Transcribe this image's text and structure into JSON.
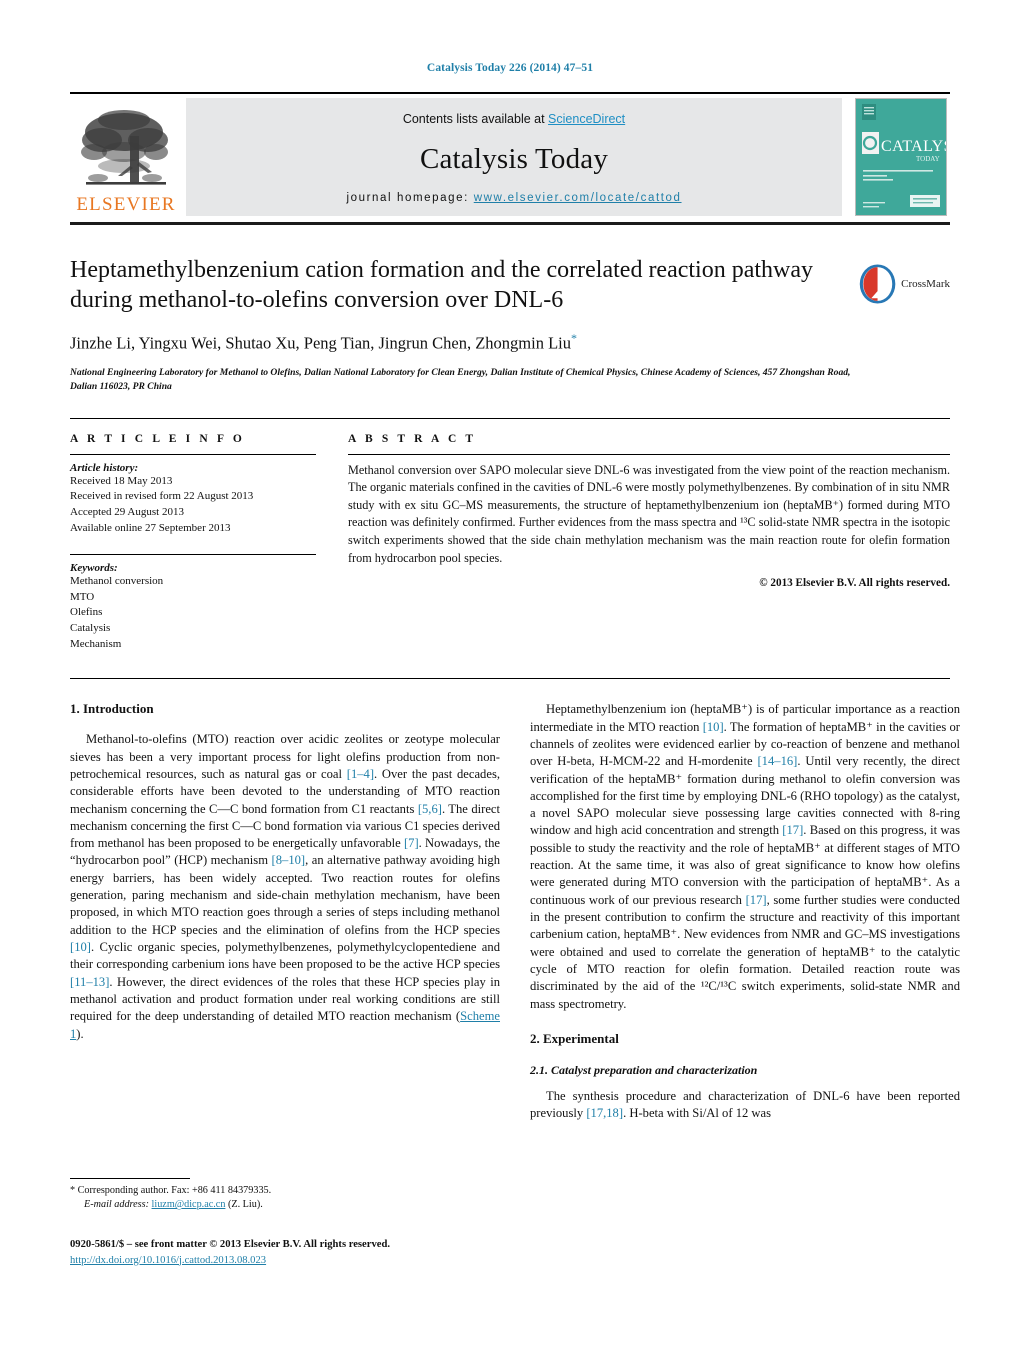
{
  "running_head": "Catalysis Today 226 (2014) 47–51",
  "header": {
    "contents_prefix": "Contents lists available at ",
    "sciencedirect": "ScienceDirect",
    "journal_title": "Catalysis Today",
    "homepage_prefix": "journal homepage:",
    "homepage_url": "www.elsevier.com/locate/cattod",
    "publisher_wordmark": "ELSEVIER",
    "cover_title": "CATALYSIS",
    "cover_subtitle": "TODAY",
    "accent_blue": "#1f7fa8",
    "elsevier_orange": "#E87722",
    "cover_teal": "#3fa89a",
    "band_gray": "#e6e7e8"
  },
  "title_block": {
    "title": "Heptamethylbenzenium cation formation and the correlated reaction pathway during methanol-to-olefins conversion over DNL-6",
    "authors": "Jinzhe Li, Yingxu Wei, Shutao Xu, Peng Tian, Jingrun Chen, Zhongmin Liu",
    "corresponding_marker": "*",
    "affiliation": "National Engineering Laboratory for Methanol to Olefins, Dalian National Laboratory for Clean Energy, Dalian Institute of Chemical Physics, Chinese Academy of Sciences, 457 Zhongshan Road, Dalian 116023, PR China",
    "crossmark_label": "CrossMark"
  },
  "article_info": {
    "heading": "A R T I C L E   I N F O",
    "history_label": "Article history:",
    "history": [
      "Received 18 May 2013",
      "Received in revised form 22 August 2013",
      "Accepted 29 August 2013",
      "Available online 27 September 2013"
    ],
    "keywords_label": "Keywords:",
    "keywords": [
      "Methanol conversion",
      "MTO",
      "Olefins",
      "Catalysis",
      "Mechanism"
    ]
  },
  "abstract": {
    "heading": "A B S T R A C T",
    "text": "Methanol conversion over SAPO molecular sieve DNL-6 was investigated from the view point of the reaction mechanism. The organic materials confined in the cavities of DNL-6 were mostly polymethylbenzenes. By combination of in situ NMR study with ex situ GC–MS measurements, the structure of heptamethylbenzenium ion (heptaMB⁺) formed during MTO reaction was definitely confirmed. Further evidences from the mass spectra and ¹³C solid-state NMR spectra in the isotopic switch experiments showed that the side chain methylation mechanism was the main reaction route for olefin formation from hydrocarbon pool species.",
    "copyright": "© 2013 Elsevier B.V. All rights reserved."
  },
  "body": {
    "section1_heading": "1.  Introduction",
    "intro_para1_a": "Methanol-to-olefins (MTO) reaction over acidic zeolites or zeotype molecular sieves has been a very important process for light olefins production from non-petrochemical resources, such as natural gas or coal ",
    "ref_1_4": "[1–4]",
    "intro_para1_b": ". Over the past decades, considerable efforts have been devoted to the understanding of MTO reaction mechanism concerning the C—C bond formation from C1 reactants ",
    "ref_5_6": "[5,6]",
    "intro_para1_c": ". The direct mechanism concerning the first C—C bond formation via various C1 species derived from methanol has been proposed to be energetically unfavorable ",
    "ref_7": "[7]",
    "intro_para1_d": ". Nowadays, the “hydrocarbon pool” (HCP) mechanism ",
    "ref_8_10": "[8–10]",
    "intro_para1_e": ", an alternative pathway avoiding high energy barriers, has been widely accepted. Two reaction routes for olefins generation, paring mechanism and side-chain methylation mechanism, have been proposed, in which MTO reaction goes through a series of steps including methanol addition to the HCP species and the elimination of olefins from the HCP species ",
    "ref_10": "[10]",
    "intro_para1_f": ". Cyclic organic species, polymethylbenzenes, polymethylcyclopentediene and their corresponding carbenium ions have been proposed to be the active HCP species ",
    "ref_11_13": "[11–13]",
    "intro_para1_g": ". However, the direct evidences of the roles that these HCP species play in methanol activation and product formation under real working conditions are still required for the deep understanding of detailed MTO reaction mechanism (",
    "scheme_link": "Scheme 1",
    "intro_para1_h": ").",
    "right_para1_a": "Heptamethylbenzenium ion (heptaMB⁺) is of particular importance as a reaction intermediate in the MTO reaction ",
    "r_ref_10": "[10]",
    "right_para1_b": ". The formation of heptaMB⁺ in the cavities or channels of zeolites were evidenced earlier by co-reaction of benzene and methanol over H-beta, H-MCM-22 and H-mordenite ",
    "r_ref_14_16": "[14–16]",
    "right_para1_c": ". Until very recently, the direct verification of the heptaMB⁺ formation during methanol to olefin conversion was accomplished for the first time by employing DNL-6 (RHO topology) as the catalyst, a novel SAPO molecular sieve possessing large cavities connected with 8-ring window and high acid concentration and strength ",
    "r_ref_17": "[17]",
    "right_para1_d": ". Based on this progress, it was possible to study the reactivity and the role of heptaMB⁺ at different stages of MTO reaction. At the same time, it was also of great significance to know how olefins were generated during MTO conversion with the participation of heptaMB⁺. As a continuous work of our previous research ",
    "r_ref_17b": "[17]",
    "right_para1_e": ", some further studies were conducted in the present contribution to confirm the structure and reactivity of this important carbenium cation, heptaMB⁺. New evidences from NMR and GC–MS investigations were obtained and used to correlate the generation of heptaMB⁺ to the catalytic cycle of MTO reaction for olefin formation. Detailed reaction route was discriminated by the aid of the ¹²C/¹³C switch experiments, solid-state NMR and mass spectrometry.",
    "section2_heading": "2.  Experimental",
    "section21_heading": "2.1.  Catalyst preparation and characterization",
    "exp_para_a": "The synthesis procedure and characterization of DNL-6 have been reported previously ",
    "ref_17_18": "[17,18]",
    "exp_para_b": ". H-beta with Si/Al of 12 was"
  },
  "footnotes": {
    "corresponding_marker": "*",
    "corresponding_text": "Corresponding author. Fax: +86 411 84379335.",
    "email_label": "E-mail address:",
    "email": "liuzm@dicp.ac.cn",
    "email_suffix": "(Z. Liu).",
    "issn_line": "0920-5861/$ – see front matter © 2013 Elsevier B.V. All rights reserved.",
    "doi": "http://dx.doi.org/10.1016/j.cattod.2013.08.023"
  }
}
